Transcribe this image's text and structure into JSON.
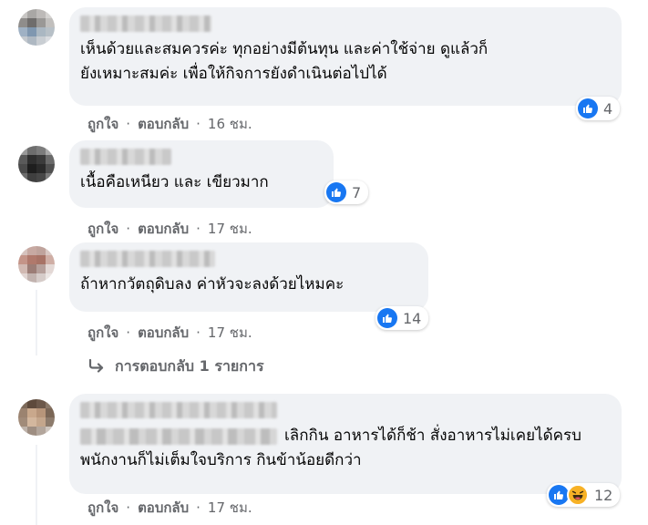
{
  "comments": [
    {
      "text": "เห็นด้วยและสมควรค่ะ ทุกอย่างมีต้นทุน และค่าใช้จ่าย ดูแล้วก็\nยังเหมาะสมค่ะ เพื่อให้กิจการยังดำเนินต่อไปได้",
      "reaction_count": "4",
      "reactions": [
        "like-icon"
      ],
      "actions": {
        "like": "ถูกใจ",
        "reply": "ตอบกลับ",
        "separator": "·",
        "time": "16 ชม."
      }
    },
    {
      "text": "เนื้อคือเหนียว และ เขียวมาก",
      "reaction_count": "7",
      "reactions": [
        "like-icon"
      ],
      "actions": {
        "like": "ถูกใจ",
        "reply": "ตอบกลับ",
        "separator": "·",
        "time": "17 ชม."
      }
    },
    {
      "text": "ถ้าหากวัตถุดิบลง ค่าหัวจะลงด้วยไหมคะ",
      "reaction_count": "14",
      "reactions": [
        "like-icon"
      ],
      "actions": {
        "like": "ถูกใจ",
        "reply": "ตอบกลับ",
        "separator": "·",
        "time": "17 ชม."
      },
      "replies_link": "การตอบกลับ 1 รายการ"
    },
    {
      "text_line1": "เลิกกิน อาหารได้ก็ช้า สั่งอาหารไม่เคยได้ครบ",
      "text_line2": "พนักงานก็ไม่เต็มใจบริการ กินข้าน้อยดีกว่า",
      "reaction_count": "12",
      "reactions": [
        "like-icon",
        "haha-icon"
      ],
      "actions": {
        "like": "ถูกใจ",
        "reply": "ตอบกลับ",
        "separator": "·",
        "time": "17 ชม."
      }
    }
  ],
  "colors": {
    "bubble": "#f0f2f5",
    "like_blue": "#1877f2",
    "haha_yellow": "#f7b125",
    "meta_text": "#65676b"
  }
}
